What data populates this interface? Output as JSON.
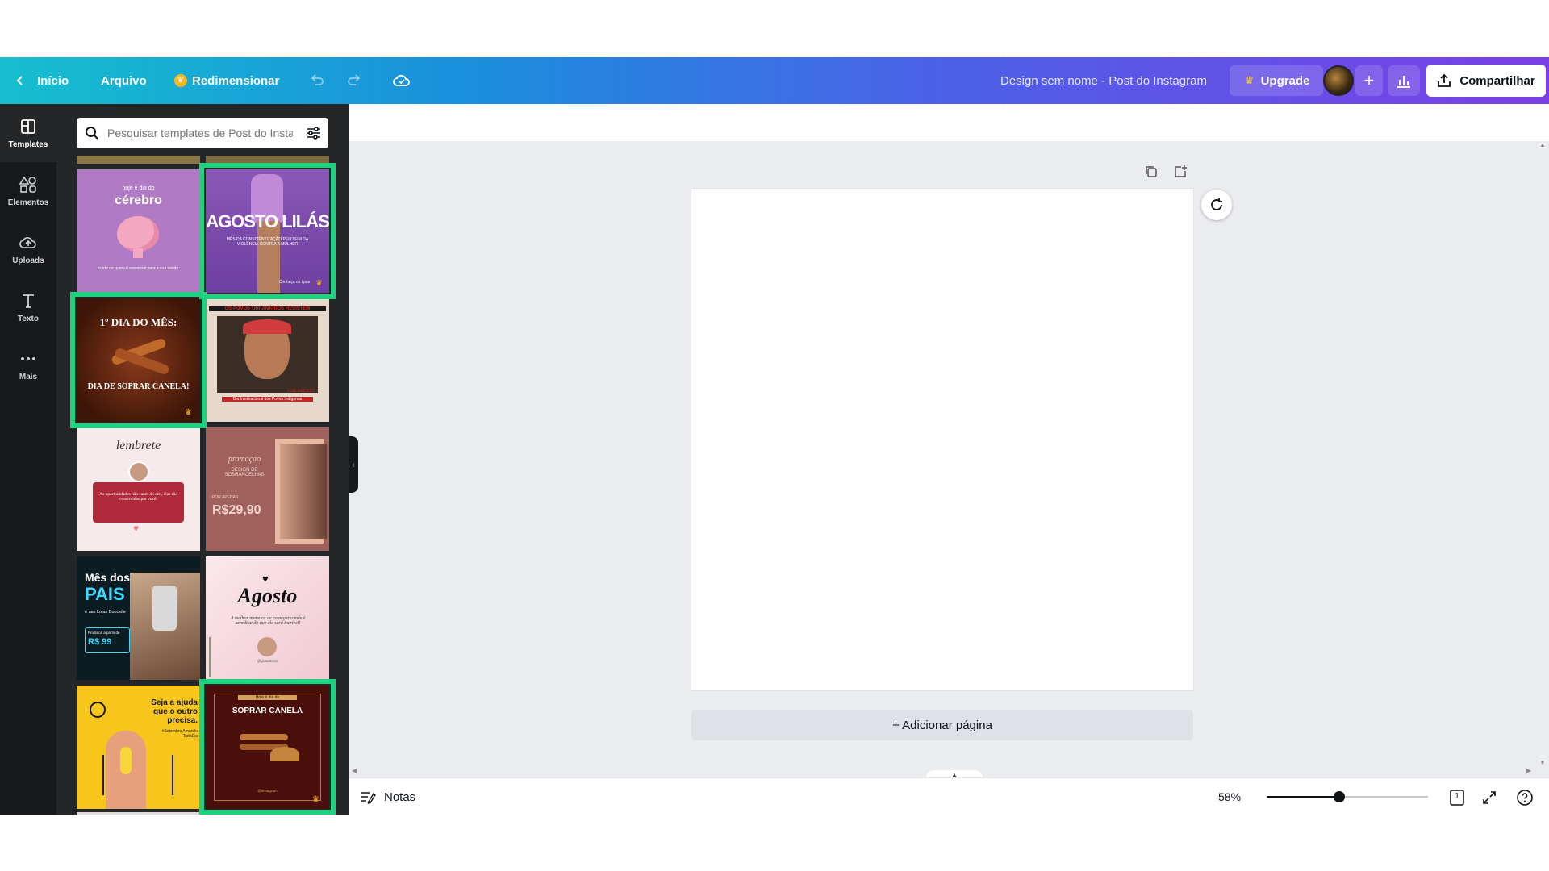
{
  "topbar": {
    "home_label": "Início",
    "file_label": "Arquivo",
    "resize_label": "Redimensionar",
    "design_title": "Design sem nome - Post do Instagram",
    "upgrade_label": "Upgrade",
    "share_label": "Compartilhar"
  },
  "rail": {
    "items": [
      {
        "label": "Templates",
        "icon": "layout-icon"
      },
      {
        "label": "Elementos",
        "icon": "shapes-icon"
      },
      {
        "label": "Uploads",
        "icon": "cloud-upload-icon"
      },
      {
        "label": "Texto",
        "icon": "text-icon"
      },
      {
        "label": "Mais",
        "icon": "more-icon"
      }
    ]
  },
  "panel": {
    "search_placeholder": "Pesquisar templates de Post do Instagram",
    "templates": [
      {
        "id": "cerebro",
        "small": "hoje é dia do",
        "title": "cérebro",
        "footer": "cuide de quem é essencial para a sua saúde"
      },
      {
        "id": "agosto-lilas",
        "title": "AGOSTO LILÁS",
        "subtitle": "MÊS DA CONSCIENTIZAÇÃO PELO FIM DA VIOLÊNCIA CONTRA A MULHER",
        "footer": "Conheça os tipos"
      },
      {
        "id": "canela",
        "title": "1º DIA DO MÊS:",
        "subtitle": "DIA DE SOPRAR CANELA!"
      },
      {
        "id": "povos",
        "title": "OS POVOS ORIGINÁRIOS RESISTEM",
        "small": "9 DE AGOSTO",
        "footer": "Dia Internacional dos Povos Indígenas"
      },
      {
        "id": "lembrete",
        "title": "lembrete",
        "body": "As oportunidades não caem do céu, elas são construídas por você."
      },
      {
        "id": "promocao",
        "title": "promoção",
        "subtitle": "DESIGN DE SOBRANCELHAS",
        "small": "POR APENAS:",
        "price": "R$29,90"
      },
      {
        "id": "pais",
        "title": "Mês dos",
        "title2": "PAIS",
        "subtitle": "é nas Lojas Boncelle",
        "small": "Produtos a partir de",
        "price": "R$ 99"
      },
      {
        "id": "agosto",
        "title": "Agosto",
        "body": "A melhor maneira de começar o mês é acreditando que ele será incrível!",
        "handle": "@grandesite"
      },
      {
        "id": "setembro",
        "title": "Seja a ajuda que o outro precisa.",
        "subtitle": "#Setembro Amarelo TodoDia"
      },
      {
        "id": "soprar",
        "small": "Hoje é dia de",
        "title": "SOPRAR CANELA",
        "footer": "@instagram"
      }
    ]
  },
  "canvas": {
    "add_page_label": "+ Adicionar página"
  },
  "bottombar": {
    "notes_label": "Notas",
    "zoom_label": "58%",
    "zoom_fraction": 0.45,
    "page_count": "1"
  },
  "colors": {
    "selection": "#1ed37f",
    "rail_bg": "#18191b",
    "panel_bg": "#252627",
    "canvas_bg": "#ebecf0"
  }
}
